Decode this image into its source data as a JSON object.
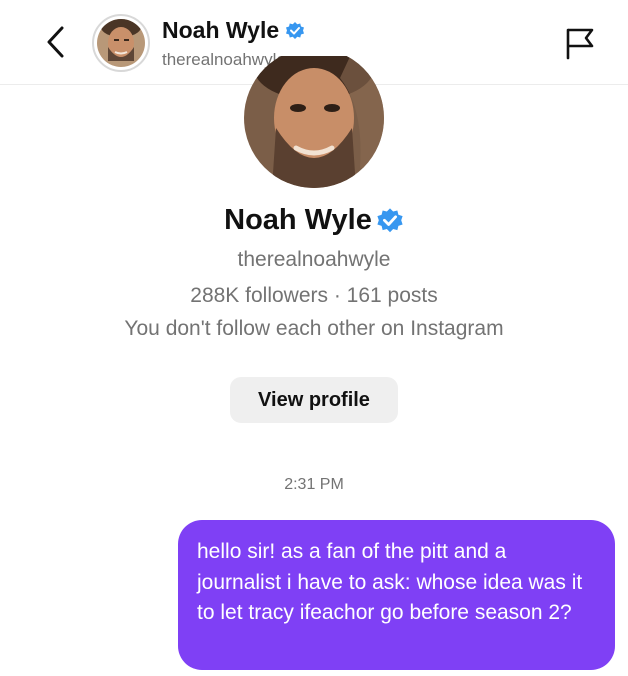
{
  "header": {
    "name": "Noah Wyle",
    "username": "therealnoahwyle",
    "back_icon": "chevron-left-icon",
    "report_icon": "flag-icon"
  },
  "profile": {
    "name": "Noah Wyle",
    "username": "therealnoahwyle",
    "stats": "288K followers · 161 posts",
    "follow_status": "You don't follow each other on Instagram",
    "view_profile_label": "View profile",
    "verified_icon": "verified-badge-icon"
  },
  "thread": {
    "timestamp": "2:31 PM",
    "messages": [
      {
        "sender": "me",
        "text": "hello sir! as a fan of the pitt and a journalist i have to ask: whose idea was it to let tracy ifeachor go before season 2?"
      }
    ]
  },
  "colors": {
    "outgoing_bubble": "#7f40f5",
    "verified_blue": "#3797f0",
    "secondary_text": "#737373",
    "button_bg": "#efefef"
  }
}
